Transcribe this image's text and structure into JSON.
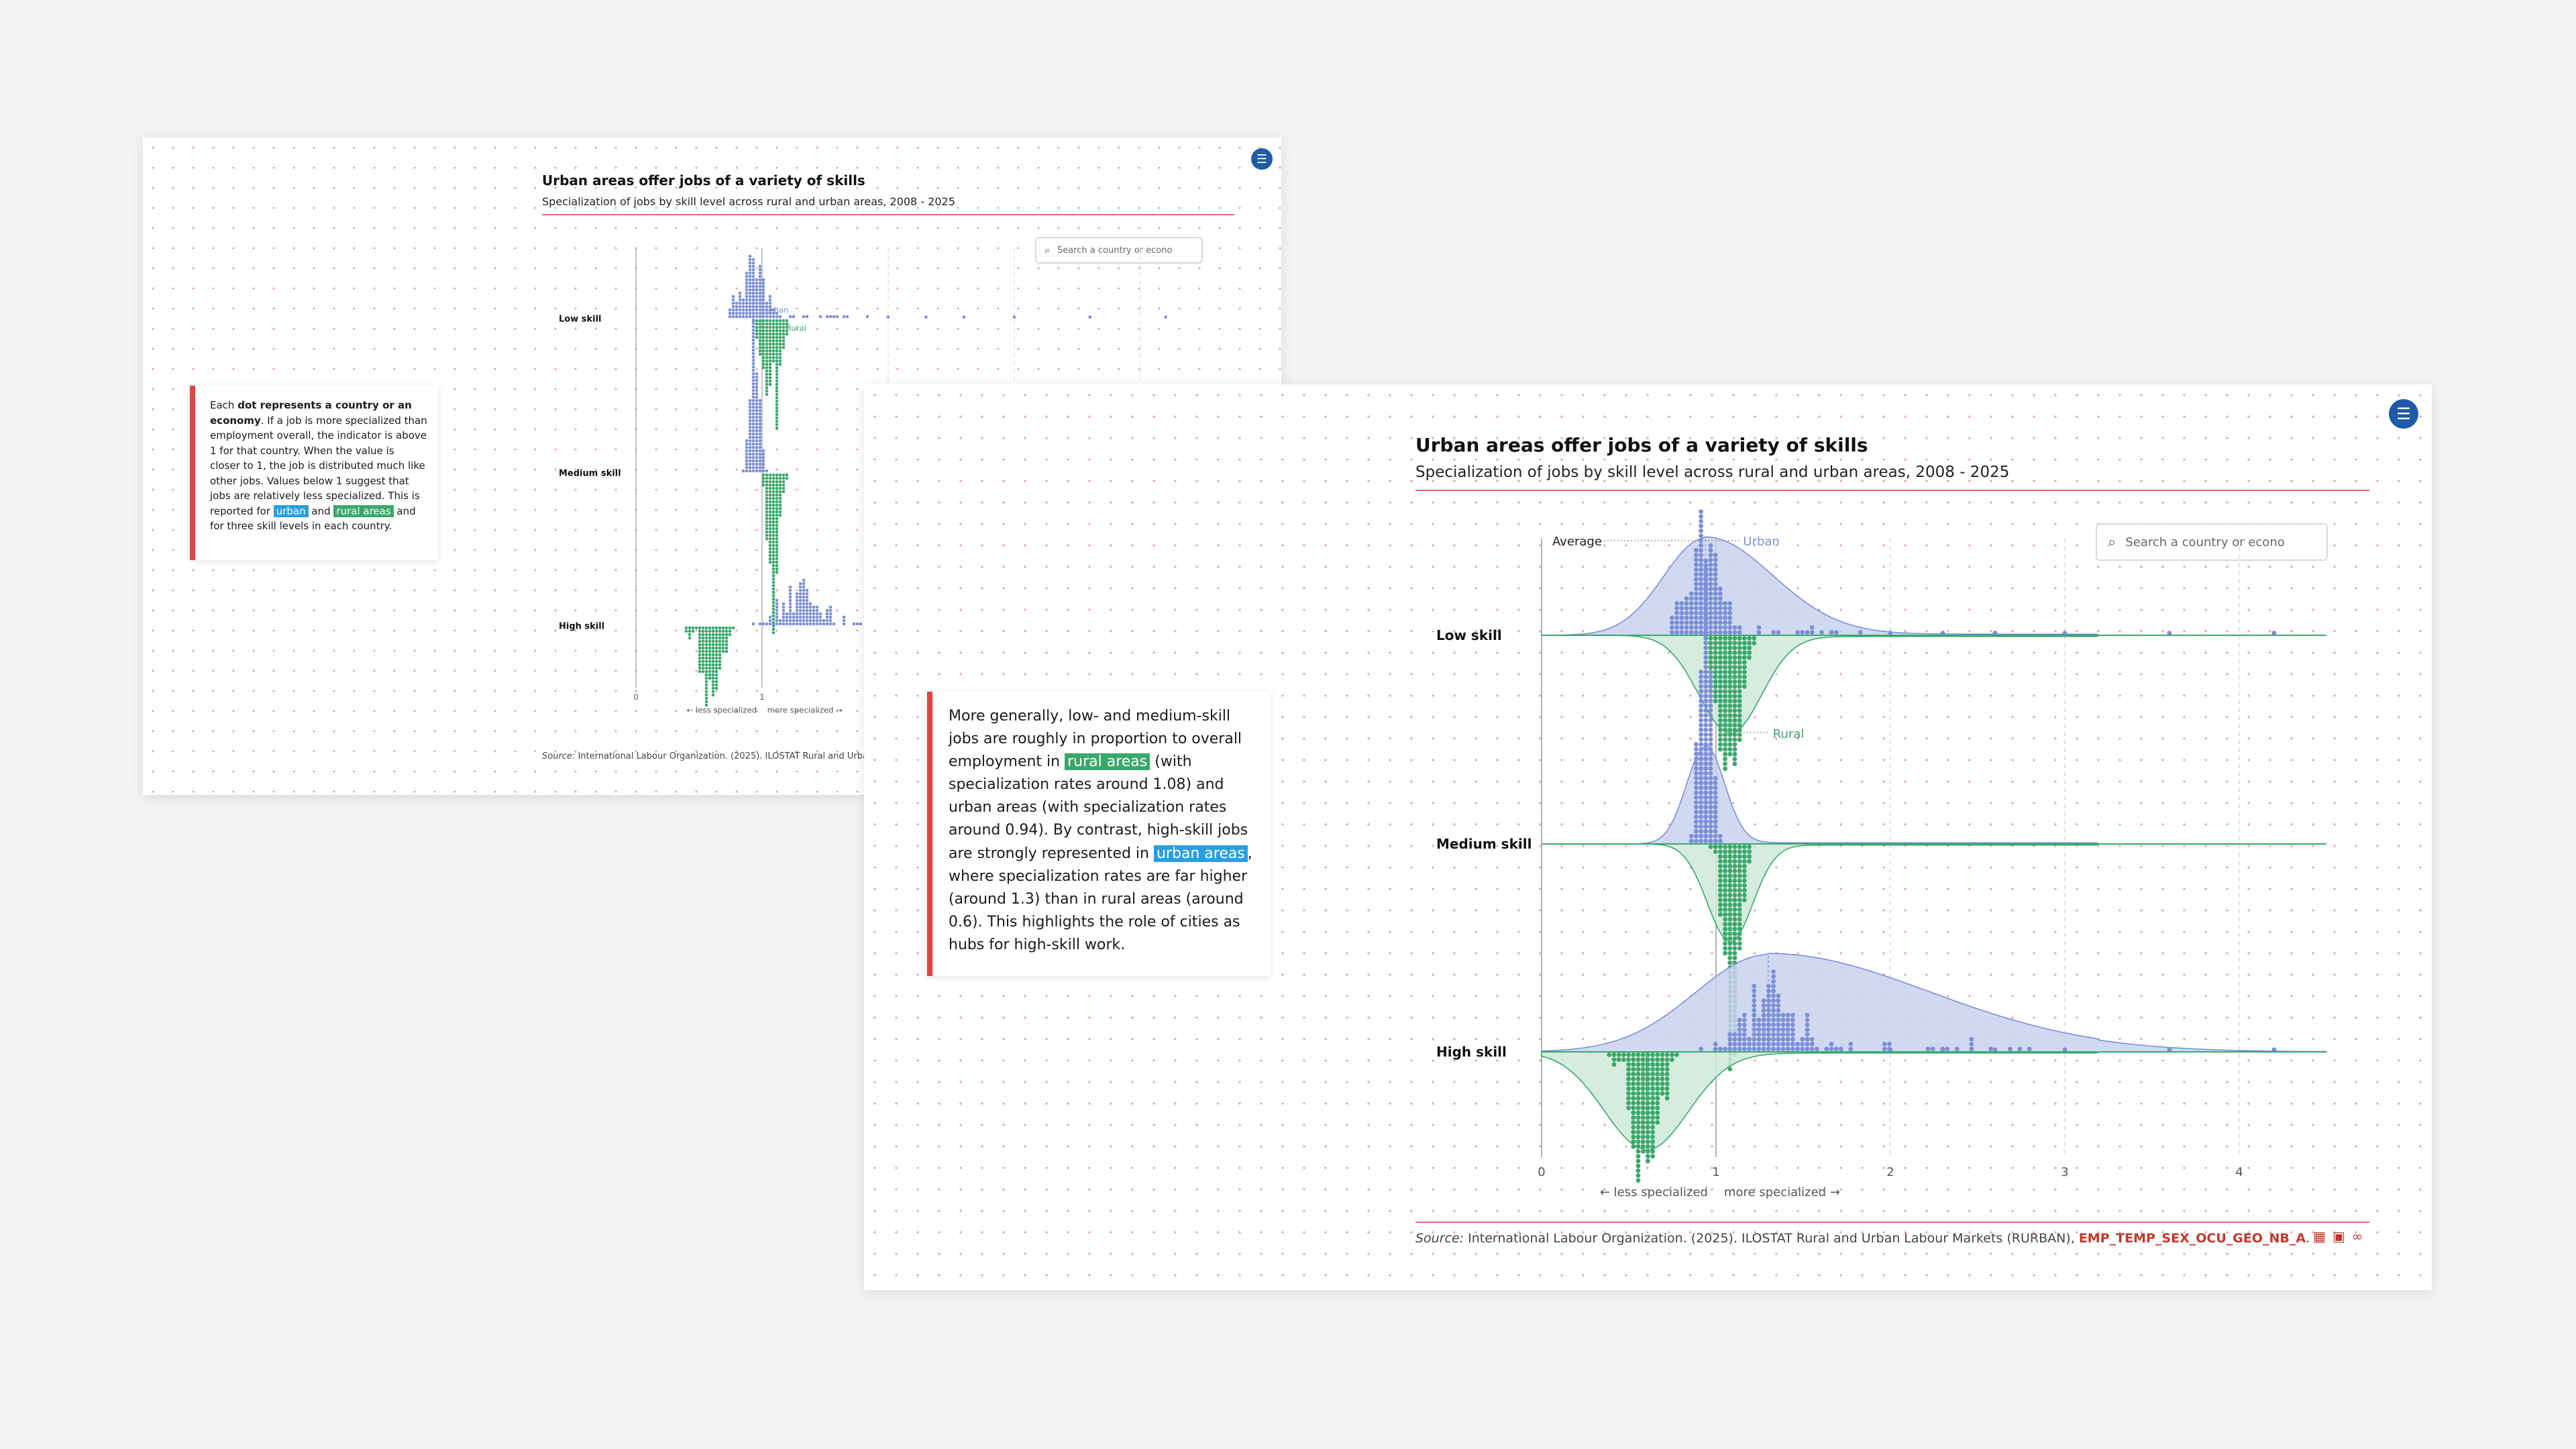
{
  "chart": {
    "title": "Urban areas offer jobs of a variety of skills",
    "subtitle": "Specialization of jobs by skill level across rural and urban areas, 2008 - 2025",
    "search_placeholder": "Search a country or econo",
    "average_label": "Average",
    "urban_label": "Urban",
    "rural_label": "Rural",
    "less_label": "← less specialized",
    "more_label": "more specialized →",
    "source_prefix": "Source:",
    "source_text": " International Labour Organization. (2025). ILOSTAT Rural and Urban Labour Markets (RURBAN), ",
    "source_code": "EMP_TEMP_SEX_OCU_GEO_NB_A",
    "source_end": ".",
    "back_source_text": " International Labour Organization. (2025). ILOSTAT Rural and Urba"
  },
  "card_back": {
    "p1": "Each ",
    "p1_bold": "dot represents a country or an economy",
    "p2": ". If a job is more specialized than employment overall, the indicator is above 1 for that country. When the value is closer to 1, the job is distributed much like other jobs. Values below 1 suggest that jobs are relatively less specialized. This is reported for ",
    "urban": "urban",
    "and": " and ",
    "rural": "rural areas",
    "p3": " and for three skill levels in each country."
  },
  "card_front": {
    "p1": "More generally, low- and medium-skill jobs are roughly in proportion to overall employment in ",
    "rural": "rural areas",
    "p2": " (with specialization rates around 1.08) and urban areas (with specialization rates around 0.94). By contrast, high-skill jobs are strongly represented in ",
    "urban": "urban areas",
    "p3": ", where specialization rates are far higher (around 1.3) than in rural areas (around 0.6). This highlights the role of cities as hubs for high-skill work."
  },
  "chart_data": {
    "type": "scatter",
    "title": "Urban areas offer jobs of a variety of skills",
    "subtitle": "Specialization of jobs by skill level across rural and urban areas, 2008 - 2025",
    "categories": [
      "Low skill",
      "Medium skill",
      "High skill"
    ],
    "x_ticks": [
      0,
      1,
      2,
      3,
      4
    ],
    "xlim": [
      0,
      4.5
    ],
    "grid": true,
    "series": [
      {
        "name": "Urban",
        "color": "#7b8fd6",
        "area_color": "#c9d2ef",
        "medians": [
          0.94,
          0.94,
          1.3
        ],
        "spread": [
          0.24,
          0.11,
          0.42
        ]
      },
      {
        "name": "Rural",
        "color": "#3aa86a",
        "area_color": "#cfe9d9",
        "medians": [
          1.08,
          1.08,
          0.6
        ],
        "spread": [
          0.18,
          0.13,
          0.24
        ]
      }
    ]
  }
}
